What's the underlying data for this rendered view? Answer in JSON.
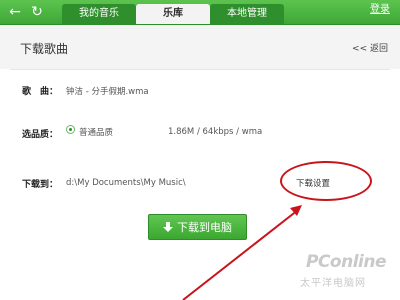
{
  "topbar": {
    "tabs": [
      {
        "label": "我的音乐"
      },
      {
        "label": "乐库"
      },
      {
        "label": "本地管理"
      }
    ],
    "login_label": "登录"
  },
  "header": {
    "title": "下载歌曲",
    "back_label": "<< 返回"
  },
  "song": {
    "label": "歌　曲：",
    "value": "钟洁 - 分手假期.wma"
  },
  "quality": {
    "label": "选品质：",
    "option_label": "普通品质",
    "detail": "1.86M / 64kbps / wma"
  },
  "download_to": {
    "label": "下载到：",
    "path": "d:\\My Documents\\My Music\\",
    "settings_label": "下载设置"
  },
  "download_button": {
    "label": "下载到电脑"
  },
  "watermark": {
    "logo": "PConline",
    "sub": "太平洋电脑网"
  },
  "colors": {
    "accent": "#3ea737",
    "annotation": "#c8141a"
  }
}
